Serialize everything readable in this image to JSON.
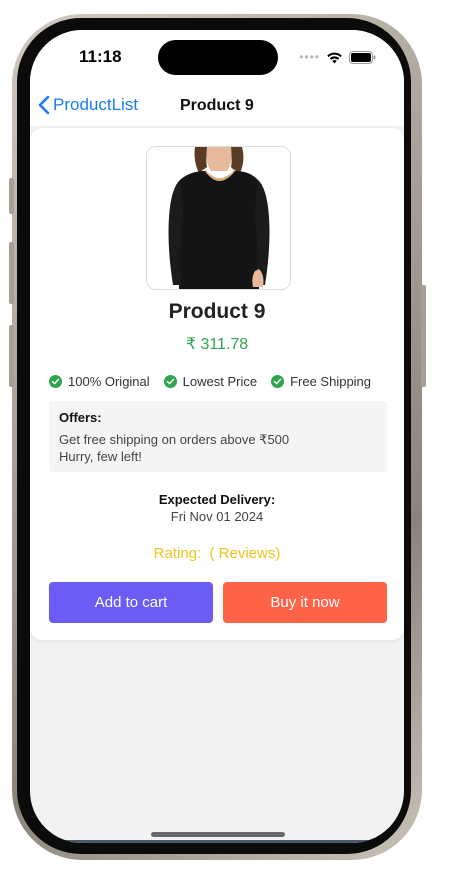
{
  "status_bar": {
    "time": "11:18",
    "signal_icon": "signal-dots-icon",
    "wifi_icon": "wifi-icon",
    "battery_icon": "battery-icon"
  },
  "nav": {
    "back_label": "ProductList",
    "back_icon": "chevron-left-icon",
    "title": "Product 9"
  },
  "product": {
    "name": "Product 9",
    "price": "₹ 311.78",
    "image": "black-long-sleeve-top"
  },
  "features": [
    {
      "label": "100% Original",
      "icon": "check-circle-icon"
    },
    {
      "label": "Lowest Price",
      "icon": "check-circle-icon"
    },
    {
      "label": "Free Shipping",
      "icon": "check-circle-icon"
    }
  ],
  "offers": {
    "title": "Offers:",
    "lines": [
      "Get free shipping on orders above ₹500",
      "Hurry, few left!"
    ]
  },
  "delivery": {
    "label": "Expected Delivery:",
    "date": "Fri Nov 01 2024"
  },
  "rating": {
    "text": "Rating:  ( Reviews)"
  },
  "actions": {
    "add_to_cart": "Add to cart",
    "buy_now": "Buy it now"
  },
  "colors": {
    "accent_blue": "#1a7cf5",
    "price_green": "#2ea44f",
    "rating_yellow": "#f2c21a",
    "cart_purple": "#6b5cf6",
    "buy_orange": "#fe6347"
  }
}
